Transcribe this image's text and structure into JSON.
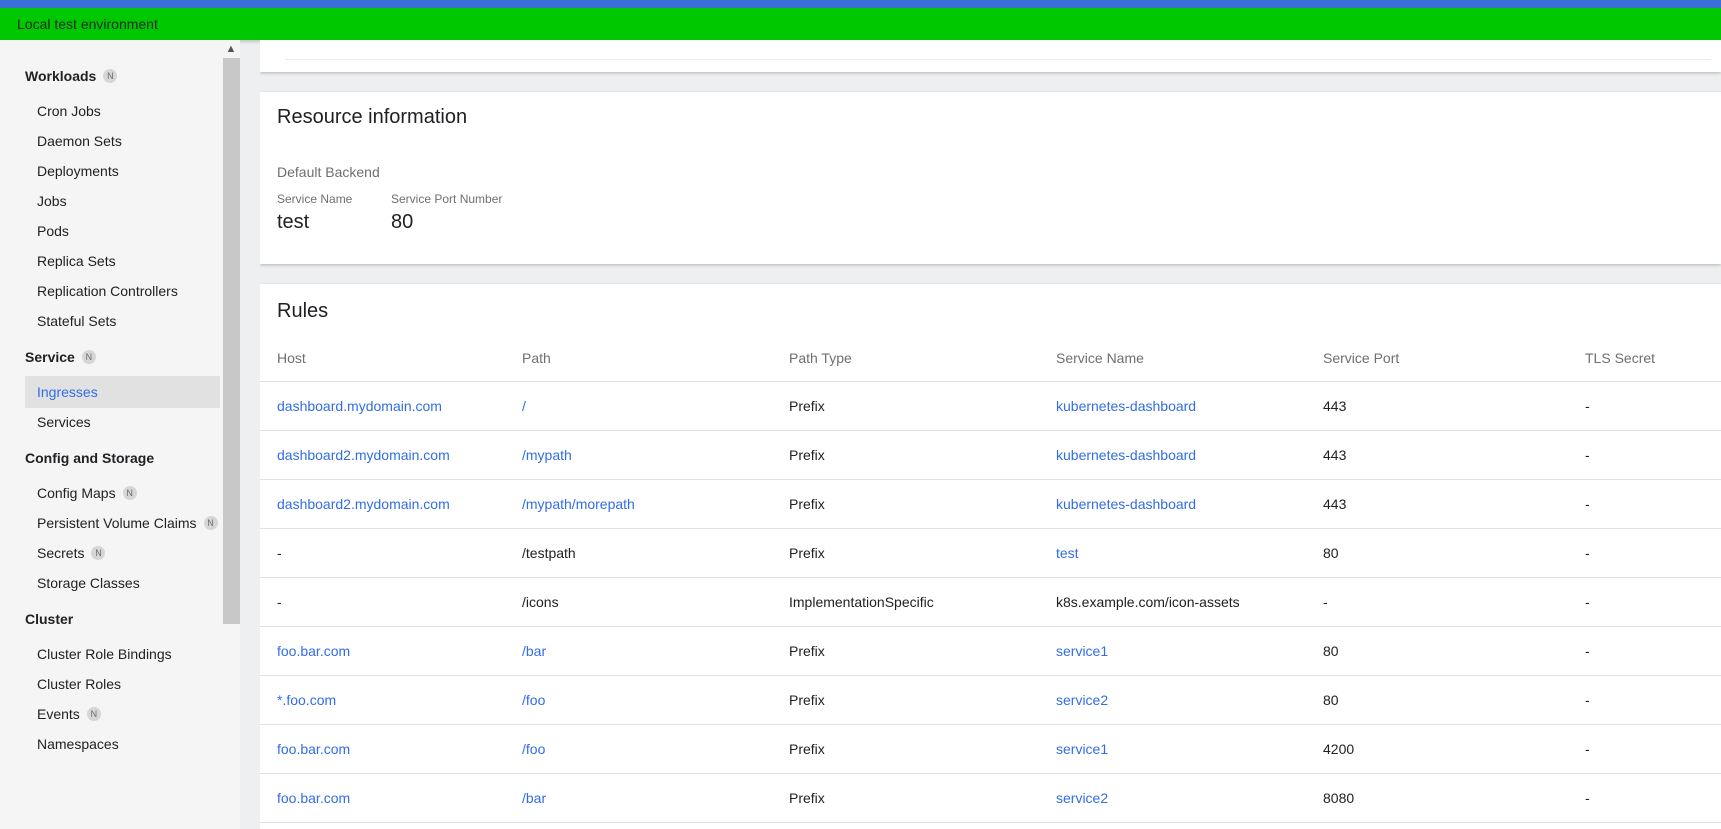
{
  "env_banner": "Local test environment",
  "sidebar": {
    "sections": [
      {
        "title": "Workloads",
        "badge": "N",
        "items": [
          {
            "label": "Cron Jobs"
          },
          {
            "label": "Daemon Sets"
          },
          {
            "label": "Deployments"
          },
          {
            "label": "Jobs"
          },
          {
            "label": "Pods"
          },
          {
            "label": "Replica Sets"
          },
          {
            "label": "Replication Controllers"
          },
          {
            "label": "Stateful Sets"
          }
        ]
      },
      {
        "title": "Service",
        "badge": "N",
        "items": [
          {
            "label": "Ingresses",
            "active": true
          },
          {
            "label": "Services"
          }
        ]
      },
      {
        "title": "Config and Storage",
        "badge": "",
        "items": [
          {
            "label": "Config Maps",
            "badge": "N"
          },
          {
            "label": "Persistent Volume Claims",
            "badge": "N"
          },
          {
            "label": "Secrets",
            "badge": "N"
          },
          {
            "label": "Storage Classes"
          }
        ]
      },
      {
        "title": "Cluster",
        "badge": "",
        "items": [
          {
            "label": "Cluster Role Bindings"
          },
          {
            "label": "Cluster Roles"
          },
          {
            "label": "Events",
            "badge": "N"
          },
          {
            "label": "Namespaces"
          }
        ]
      }
    ]
  },
  "resource_info": {
    "title": "Resource information",
    "default_backend_label": "Default Backend",
    "service_name_label": "Service Name",
    "service_name_value": "test",
    "service_port_label": "Service Port Number",
    "service_port_value": "80"
  },
  "rules": {
    "title": "Rules",
    "columns": [
      "Host",
      "Path",
      "Path Type",
      "Service Name",
      "Service Port",
      "TLS Secret"
    ],
    "rows": [
      {
        "host": "dashboard.mydomain.com",
        "host_link": true,
        "path": "/",
        "path_link": true,
        "path_type": "Prefix",
        "service": "kubernetes-dashboard",
        "service_link": true,
        "port": "443",
        "tls": "-"
      },
      {
        "host": "dashboard2.mydomain.com",
        "host_link": true,
        "path": "/mypath",
        "path_link": true,
        "path_type": "Prefix",
        "service": "kubernetes-dashboard",
        "service_link": true,
        "port": "443",
        "tls": "-"
      },
      {
        "host": "dashboard2.mydomain.com",
        "host_link": true,
        "path": "/mypath/morepath",
        "path_link": true,
        "path_type": "Prefix",
        "service": "kubernetes-dashboard",
        "service_link": true,
        "port": "443",
        "tls": "-"
      },
      {
        "host": "-",
        "host_link": false,
        "path": "/testpath",
        "path_link": false,
        "path_type": "Prefix",
        "service": "test",
        "service_link": true,
        "port": "80",
        "tls": "-"
      },
      {
        "host": "-",
        "host_link": false,
        "path": "/icons",
        "path_link": false,
        "path_type": "ImplementationSpecific",
        "service": "k8s.example.com/icon-assets",
        "service_link": false,
        "port": "-",
        "tls": "-"
      },
      {
        "host": "foo.bar.com",
        "host_link": true,
        "path": "/bar",
        "path_link": true,
        "path_type": "Prefix",
        "service": "service1",
        "service_link": true,
        "port": "80",
        "tls": "-"
      },
      {
        "host": "*.foo.com",
        "host_link": true,
        "path": "/foo",
        "path_link": true,
        "path_type": "Prefix",
        "service": "service2",
        "service_link": true,
        "port": "80",
        "tls": "-"
      },
      {
        "host": "foo.bar.com",
        "host_link": true,
        "path": "/foo",
        "path_link": true,
        "path_type": "Prefix",
        "service": "service1",
        "service_link": true,
        "port": "4200",
        "tls": "-"
      },
      {
        "host": "foo.bar.com",
        "host_link": true,
        "path": "/bar",
        "path_link": true,
        "path_type": "Prefix",
        "service": "service2",
        "service_link": true,
        "port": "8080",
        "tls": "-"
      }
    ]
  },
  "colors": {
    "link": "#326de6",
    "env_banner": "#00c800",
    "top_strip": "#3a6fd8"
  }
}
